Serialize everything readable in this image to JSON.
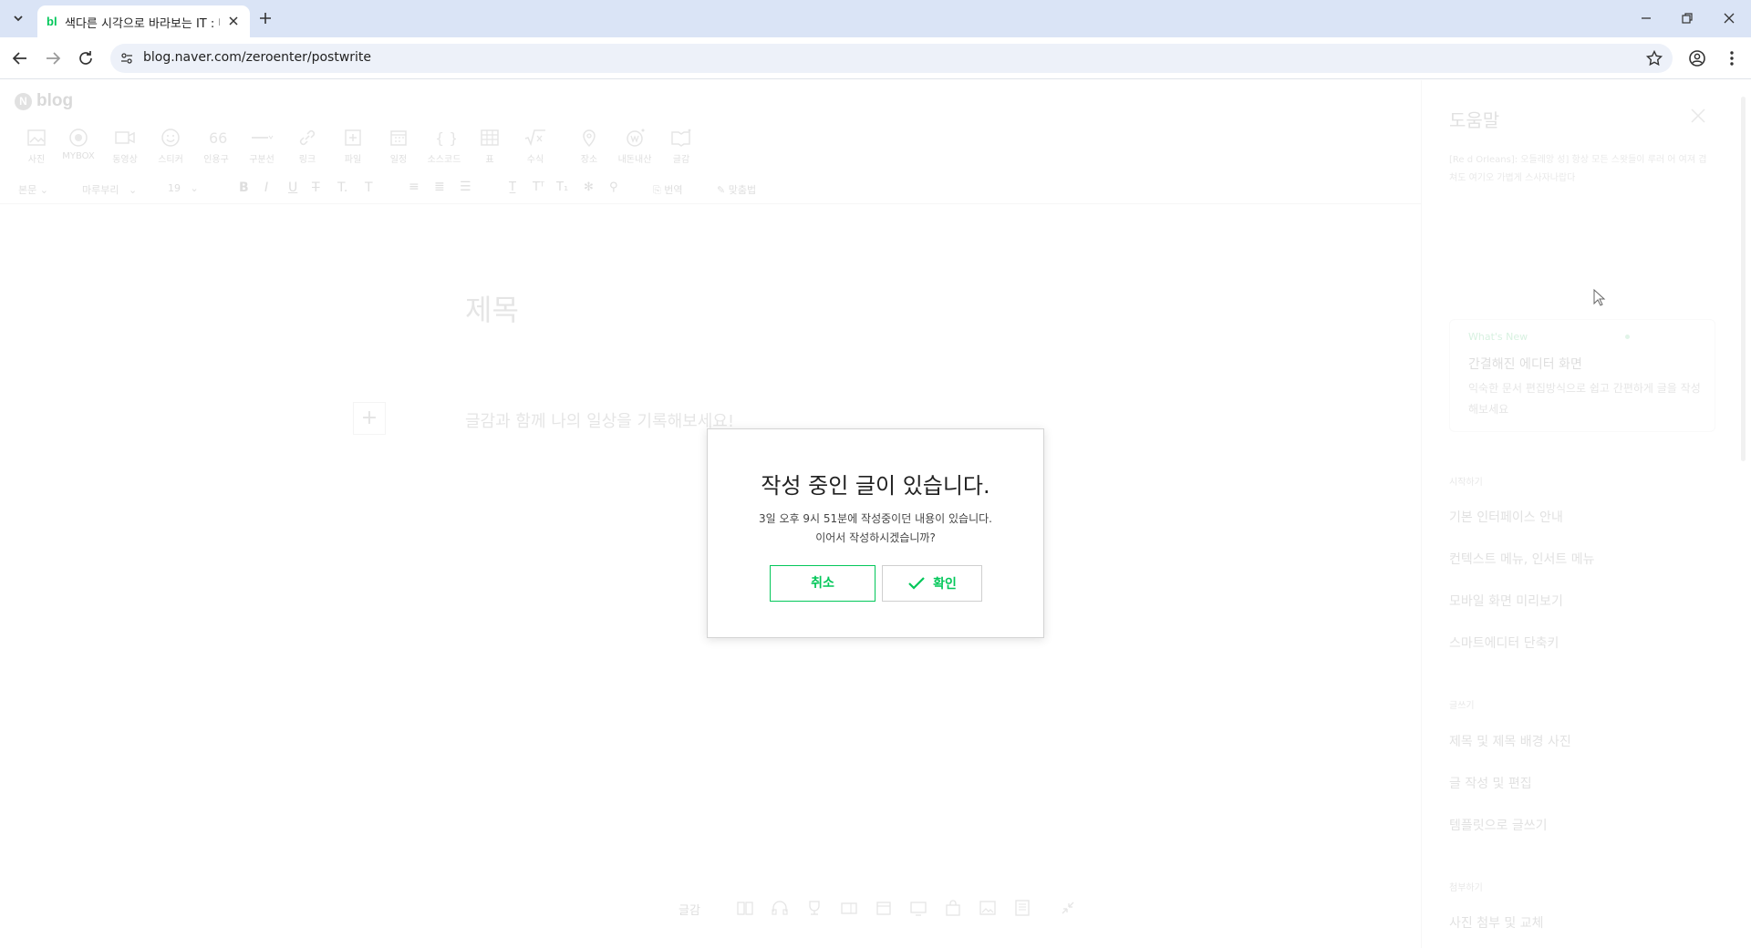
{
  "browser": {
    "tab": {
      "favicon": "bl",
      "title": "색다른 시각으로 바라보는 IT : 네이버"
    },
    "url": "blog.naver.com/zeroenter/postwrite"
  },
  "editor": {
    "logo": {
      "mark": "N",
      "text": "blog"
    },
    "toolbar": [
      "사진",
      "MYBOX",
      "동영상",
      "스티커",
      "인용구",
      "구분선",
      "링크",
      "파일",
      "일정",
      "소스코드",
      "표",
      "수식",
      "장소",
      "내돈내산",
      "글감"
    ],
    "format_bar": {
      "paragraph": "본문",
      "font": "마루부리",
      "size": "19",
      "translate": "번역",
      "spellcheck": "맞춤법"
    },
    "title_placeholder": "제목",
    "body_placeholder": "글감과 함께 나의 일상을 기록해보세요!",
    "plus_symbol": "+",
    "bottom_label": "글감"
  },
  "help_panel": {
    "title": "도움말",
    "description": "[Re d Orleans]: 오들레앙 성] 항상 모든 스왓들이 루러 어 여져 겹쳐도 여기오 가볍게 스사자나랍다",
    "whats_new": {
      "label": "What's New",
      "title": "간결해진 에디터 화면",
      "desc": "익숙한 문서 편집방식으로 쉽고 간편하게 글을 작성해보세요"
    },
    "sections": [
      {
        "title": "시작하기",
        "items": [
          "기본 인터페이스 안내",
          "컨텍스트 메뉴, 인서트 메뉴",
          "모바일 화면 미리보기",
          "스마트에디터 단축키"
        ]
      },
      {
        "title": "글쓰기",
        "items": [
          "제목 및 제목 배경 사진",
          "글 작성 및 편집",
          "템플릿으로 글쓰기"
        ]
      },
      {
        "title": "첨부하기",
        "items": [
          "사진 첨부 및 교체"
        ]
      }
    ]
  },
  "dialog": {
    "title": "작성 중인 글이 있습니다.",
    "message_line1": "3일 오후 9시 51분에 작성중이던 내용이 있습니다.",
    "message_line2": "이어서 작성하시겠습니까?",
    "cancel_label": "취소",
    "confirm_label": "확인"
  },
  "colors": {
    "accent": "#03c75a",
    "tabstrip": "#dae4f6"
  }
}
